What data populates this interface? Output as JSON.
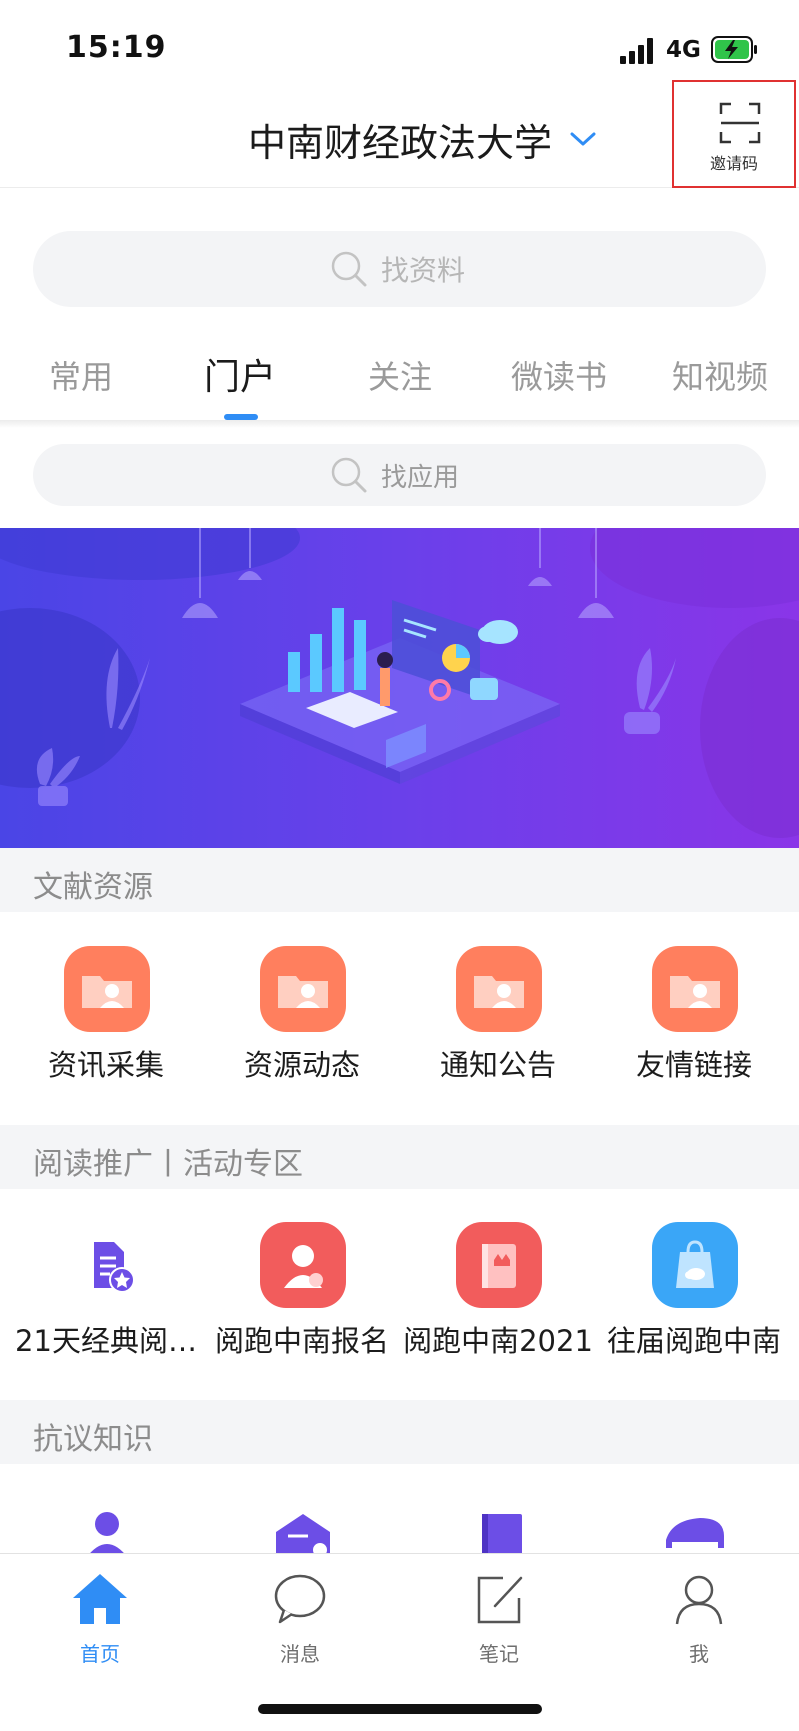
{
  "status": {
    "time": "15:19",
    "network": "4G"
  },
  "header": {
    "title": "中南财经政法大学",
    "invite_label": "邀请码"
  },
  "search_main": {
    "placeholder": "找资料"
  },
  "tabs": [
    {
      "label": "常用"
    },
    {
      "label": "门户"
    },
    {
      "label": "关注"
    },
    {
      "label": "微读书"
    },
    {
      "label": "知视频"
    }
  ],
  "search_apps": {
    "placeholder": "找应用"
  },
  "sections": [
    {
      "title": "文献资源",
      "items": [
        {
          "label": "资讯采集",
          "icon": "folder-user-icon",
          "color": "#ff7f5e"
        },
        {
          "label": "资源动态",
          "icon": "folder-user-icon",
          "color": "#ff7f5e"
        },
        {
          "label": "通知公告",
          "icon": "folder-user-icon",
          "color": "#ff7f5e"
        },
        {
          "label": "友情链接",
          "icon": "folder-user-icon",
          "color": "#ff7f5e"
        }
      ]
    },
    {
      "title": "阅读推广丨活动专区",
      "items": [
        {
          "label": "21天经典阅…",
          "icon": "document-star-icon",
          "color": "#6c4ee6"
        },
        {
          "label": "阅跑中南报名",
          "icon": "person-icon",
          "color": "#f25c5c"
        },
        {
          "label": "阅跑中南2021",
          "icon": "book-crown-icon",
          "color": "#f25c5c"
        },
        {
          "label": "往届阅跑中南",
          "icon": "bag-cloud-icon",
          "color": "#3aa6f7"
        }
      ]
    },
    {
      "title": "抗议知识",
      "items": [
        {
          "label": "",
          "icon": "doctor-icon",
          "color": "#6c4ee6"
        },
        {
          "label": "",
          "icon": "hat-check-icon",
          "color": "#6c4ee6"
        },
        {
          "label": "",
          "icon": "book-icon",
          "color": "#6c4ee6"
        },
        {
          "label": "",
          "icon": "piano-icon",
          "color": "#6c4ee6"
        }
      ]
    }
  ],
  "tabbar": [
    {
      "label": "首页",
      "icon": "home-icon",
      "active": true
    },
    {
      "label": "消息",
      "icon": "chat-icon",
      "active": false
    },
    {
      "label": "笔记",
      "icon": "note-edit-icon",
      "active": false
    },
    {
      "label": "我",
      "icon": "user-icon",
      "active": false
    }
  ],
  "colors": {
    "accent": "#2f8df5",
    "invite_highlight": "#e03131",
    "banner_start": "#4a45e6",
    "banner_end": "#8a35e8"
  }
}
